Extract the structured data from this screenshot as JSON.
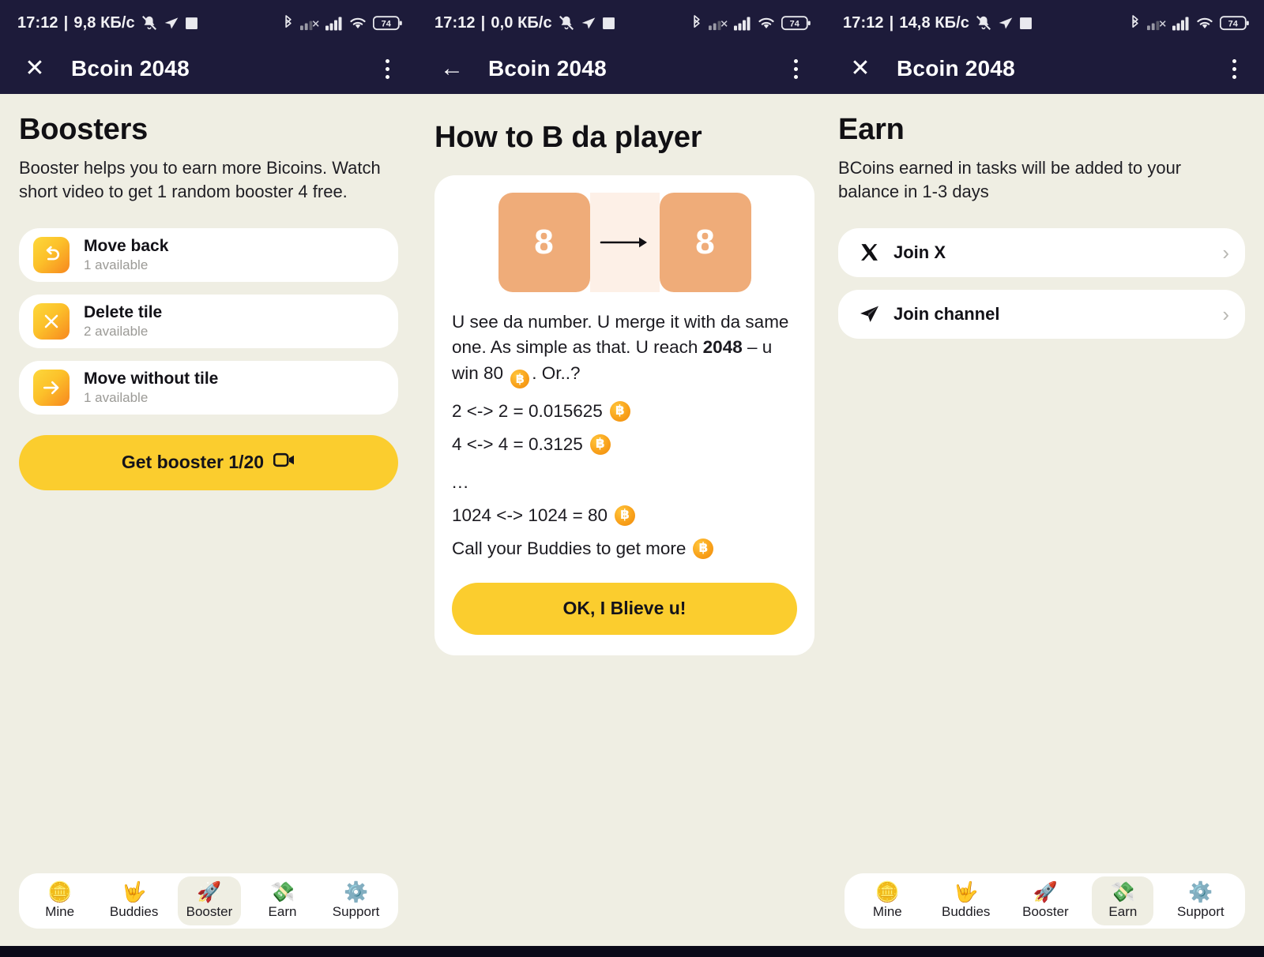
{
  "app": {
    "title": "Bcoin 2048"
  },
  "status_bars": [
    {
      "clock": "17:12",
      "separator": "|",
      "speed": "9,8 КБ/c",
      "icons": [
        "mute-icon",
        "telegram-icon",
        "square-icon"
      ],
      "right_icons": [
        "bluetooth-icon",
        "signal-1-icon",
        "signal-2-icon",
        "wifi-icon"
      ],
      "battery": "74"
    },
    {
      "clock": "17:12",
      "separator": "|",
      "speed": "0,0 КБ/c",
      "icons": [
        "mute-icon",
        "telegram-icon",
        "square-icon"
      ],
      "right_icons": [
        "bluetooth-icon",
        "signal-1-icon",
        "signal-2-icon",
        "wifi-icon"
      ],
      "battery": "74"
    },
    {
      "clock": "17:12",
      "separator": "|",
      "speed": "14,8 КБ/c",
      "icons": [
        "mute-icon",
        "telegram-icon",
        "square-icon"
      ],
      "right_icons": [
        "bluetooth-icon",
        "signal-1-icon",
        "signal-2-icon",
        "wifi-icon"
      ],
      "battery": "74"
    }
  ],
  "appbars": [
    {
      "nav_icon": "close-icon",
      "nav_glyph": "✕",
      "title": "Bcoin 2048",
      "menu_icon": "kebab-menu-icon"
    },
    {
      "nav_icon": "back-arrow-icon",
      "nav_glyph": "←",
      "title": "Bcoin 2048",
      "menu_icon": "kebab-menu-icon"
    },
    {
      "nav_icon": "close-icon",
      "nav_glyph": "✕",
      "title": "Bcoin 2048",
      "menu_icon": "kebab-menu-icon"
    }
  ],
  "boosters_screen": {
    "title": "Boosters",
    "description": "Booster helps you to earn more Bicoins. Watch short video to get 1 random booster 4 free.",
    "items": [
      {
        "icon": "undo-arrow-icon",
        "title": "Move back",
        "availability": "1 available"
      },
      {
        "icon": "x-cross-icon",
        "title": "Delete tile",
        "availability": "2 available"
      },
      {
        "icon": "right-arrow-icon",
        "title": "Move without tile",
        "availability": "1 available"
      }
    ],
    "cta_label": "Get booster 1/20",
    "cta_icon": "video-camera-icon"
  },
  "howto_screen": {
    "title": "How to B da player",
    "demo": {
      "left_tile": "8",
      "right_tile": "8",
      "arrow_icon": "right-arrow-icon"
    },
    "paragraph_part1": "U see da number. U merge it with da same one. As simple as that. U reach ",
    "paragraph_bold": "2048",
    "paragraph_part2": " – u win 80 ",
    "paragraph_part3": ". Or..?",
    "rates": [
      {
        "text": "2 <-> 2 = 0.015625",
        "coin": "bitcoin-coin-icon"
      },
      {
        "text": "4 <-> 4 = 0.3125",
        "coin": "bitcoin-coin-icon"
      }
    ],
    "ellipsis": "...",
    "rate_last": {
      "text": "1024 <-> 1024 = 80",
      "coin": "bitcoin-coin-icon"
    },
    "buddies_line": "Call your Buddies to get more",
    "cta_label": "OK, I Blieve u!"
  },
  "earn_screen": {
    "title": "Earn",
    "description": "BCoins earned in tasks will be added to your balance in 1-3 days",
    "tasks": [
      {
        "icon": "x-twitter-icon",
        "label": "Join X",
        "chevron": "chevron-right-icon"
      },
      {
        "icon": "telegram-icon",
        "label": "Join channel",
        "chevron": "chevron-right-icon"
      }
    ]
  },
  "bottom_nav": {
    "items": [
      {
        "icon": "coin-emoji",
        "emoji": "🪙",
        "label": "Mine"
      },
      {
        "icon": "love-you-gesture-emoji",
        "emoji": "🤟",
        "label": "Buddies"
      },
      {
        "icon": "rocket-emoji",
        "emoji": "🚀",
        "label": "Booster"
      },
      {
        "icon": "money-with-wings-emoji",
        "emoji": "💸",
        "label": "Earn"
      },
      {
        "icon": "gear-emoji",
        "emoji": "⚙️",
        "label": "Support"
      }
    ],
    "active_left": "Booster",
    "active_right": "Earn"
  },
  "colors": {
    "accent_yellow": "#fbcd2e",
    "background": "#efeee3",
    "appbar": "#1d1b3a",
    "tile_orange": "#efac79",
    "card_white": "#ffffff"
  }
}
